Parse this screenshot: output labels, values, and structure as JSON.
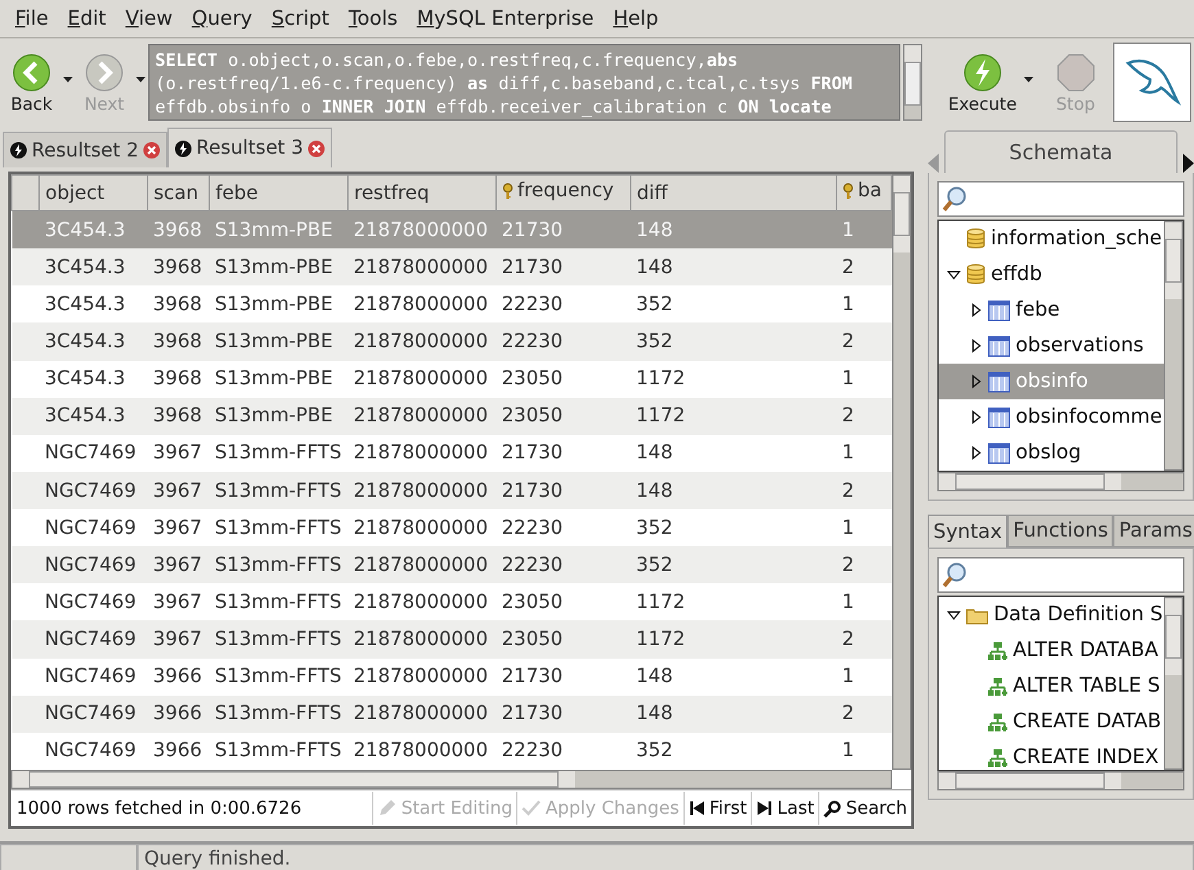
{
  "menu": [
    "File",
    "Edit",
    "View",
    "Query",
    "Script",
    "Tools",
    "MySQL Enterprise",
    "Help"
  ],
  "toolbar": {
    "back": "Back",
    "next": "Next",
    "execute": "Execute",
    "stop": "Stop"
  },
  "query": [
    "**SELECT** o.object,o.scan,o.febe,o.restfreq,c.frequency,**abs**",
    "(o.restfreq/1.e6-c.frequency) **as** diff,c.baseband,c.tcal,c.tsys **FROM**",
    "effdb.obsinfo o **INNER JOIN** effdb.receiver_calibration c **ON** **locate**"
  ],
  "result_tabs": [
    {
      "label": "Resultset 2",
      "selected": false
    },
    {
      "label": "Resultset 3",
      "selected": true
    }
  ],
  "table": {
    "columns": [
      {
        "label": "object",
        "key": false
      },
      {
        "label": "scan",
        "key": false
      },
      {
        "label": "febe",
        "key": false
      },
      {
        "label": "restfreq",
        "key": false
      },
      {
        "label": "frequency",
        "key": true
      },
      {
        "label": "diff",
        "key": false
      },
      {
        "label": "ba",
        "key": true
      }
    ],
    "rows": [
      {
        "selected": true,
        "cells": [
          "3C454.3",
          "3968",
          "S13mm-PBE",
          "21878000000",
          "21730",
          "148",
          "1"
        ]
      },
      {
        "selected": false,
        "cells": [
          "3C454.3",
          "3968",
          "S13mm-PBE",
          "21878000000",
          "21730",
          "148",
          "2"
        ]
      },
      {
        "selected": false,
        "cells": [
          "3C454.3",
          "3968",
          "S13mm-PBE",
          "21878000000",
          "22230",
          "352",
          "1"
        ]
      },
      {
        "selected": false,
        "cells": [
          "3C454.3",
          "3968",
          "S13mm-PBE",
          "21878000000",
          "22230",
          "352",
          "2"
        ]
      },
      {
        "selected": false,
        "cells": [
          "3C454.3",
          "3968",
          "S13mm-PBE",
          "21878000000",
          "23050",
          "1172",
          "1"
        ]
      },
      {
        "selected": false,
        "cells": [
          "3C454.3",
          "3968",
          "S13mm-PBE",
          "21878000000",
          "23050",
          "1172",
          "2"
        ]
      },
      {
        "selected": false,
        "cells": [
          "NGC7469",
          "3967",
          "S13mm-FFTS",
          "21878000000",
          "21730",
          "148",
          "1"
        ]
      },
      {
        "selected": false,
        "cells": [
          "NGC7469",
          "3967",
          "S13mm-FFTS",
          "21878000000",
          "21730",
          "148",
          "2"
        ]
      },
      {
        "selected": false,
        "cells": [
          "NGC7469",
          "3967",
          "S13mm-FFTS",
          "21878000000",
          "22230",
          "352",
          "1"
        ]
      },
      {
        "selected": false,
        "cells": [
          "NGC7469",
          "3967",
          "S13mm-FFTS",
          "21878000000",
          "22230",
          "352",
          "2"
        ]
      },
      {
        "selected": false,
        "cells": [
          "NGC7469",
          "3967",
          "S13mm-FFTS",
          "21878000000",
          "23050",
          "1172",
          "1"
        ]
      },
      {
        "selected": false,
        "cells": [
          "NGC7469",
          "3967",
          "S13mm-FFTS",
          "21878000000",
          "23050",
          "1172",
          "2"
        ]
      },
      {
        "selected": false,
        "cells": [
          "NGC7469",
          "3966",
          "S13mm-FFTS",
          "21878000000",
          "21730",
          "148",
          "1"
        ]
      },
      {
        "selected": false,
        "cells": [
          "NGC7469",
          "3966",
          "S13mm-FFTS",
          "21878000000",
          "21730",
          "148",
          "2"
        ]
      },
      {
        "selected": false,
        "cells": [
          "NGC7469",
          "3966",
          "S13mm-FFTS",
          "21878000000",
          "22230",
          "352",
          "1"
        ]
      }
    ]
  },
  "result_bar": {
    "info": "1000 rows fetched in 0:00.6726",
    "buttons": [
      {
        "label": "Start Editing",
        "disabled": true,
        "kind": "edit"
      },
      {
        "label": "Apply Changes",
        "disabled": true,
        "kind": "apply"
      },
      {
        "label": "First",
        "disabled": false,
        "kind": "first"
      },
      {
        "label": "Last",
        "disabled": false,
        "kind": "last"
      },
      {
        "label": "Search",
        "disabled": false,
        "kind": "search"
      }
    ]
  },
  "schemata": {
    "tab": "Schemata",
    "tree": [
      {
        "label": "information_sche",
        "kind": "db",
        "selected": false
      },
      {
        "label": "effdb",
        "kind": "db",
        "selected": false,
        "expanded": true,
        "children": [
          {
            "label": "febe",
            "kind": "table",
            "selected": false,
            "expanded": false
          },
          {
            "label": "observations",
            "kind": "table",
            "selected": false,
            "expanded": false
          },
          {
            "label": "obsinfo",
            "kind": "table",
            "selected": true,
            "expanded": false
          },
          {
            "label": "obsinfocomme",
            "kind": "table",
            "selected": false,
            "expanded": false
          },
          {
            "label": "obslog",
            "kind": "table",
            "selected": false,
            "expanded": false
          }
        ]
      }
    ]
  },
  "syntax": {
    "tabs": [
      {
        "label": "Syntax",
        "selected": true
      },
      {
        "label": "Functions",
        "selected": false
      },
      {
        "label": "Params",
        "selected": false
      }
    ],
    "tree": [
      {
        "label": "Data Definition S",
        "kind": "folder",
        "expanded": true,
        "children": [
          {
            "label": "ALTER DATABA",
            "kind": "stmt"
          },
          {
            "label": "ALTER TABLE S",
            "kind": "stmt"
          },
          {
            "label": "CREATE DATAB",
            "kind": "stmt"
          },
          {
            "label": "CREATE INDEX",
            "kind": "stmt"
          }
        ]
      }
    ]
  },
  "status_bar": "Query finished."
}
